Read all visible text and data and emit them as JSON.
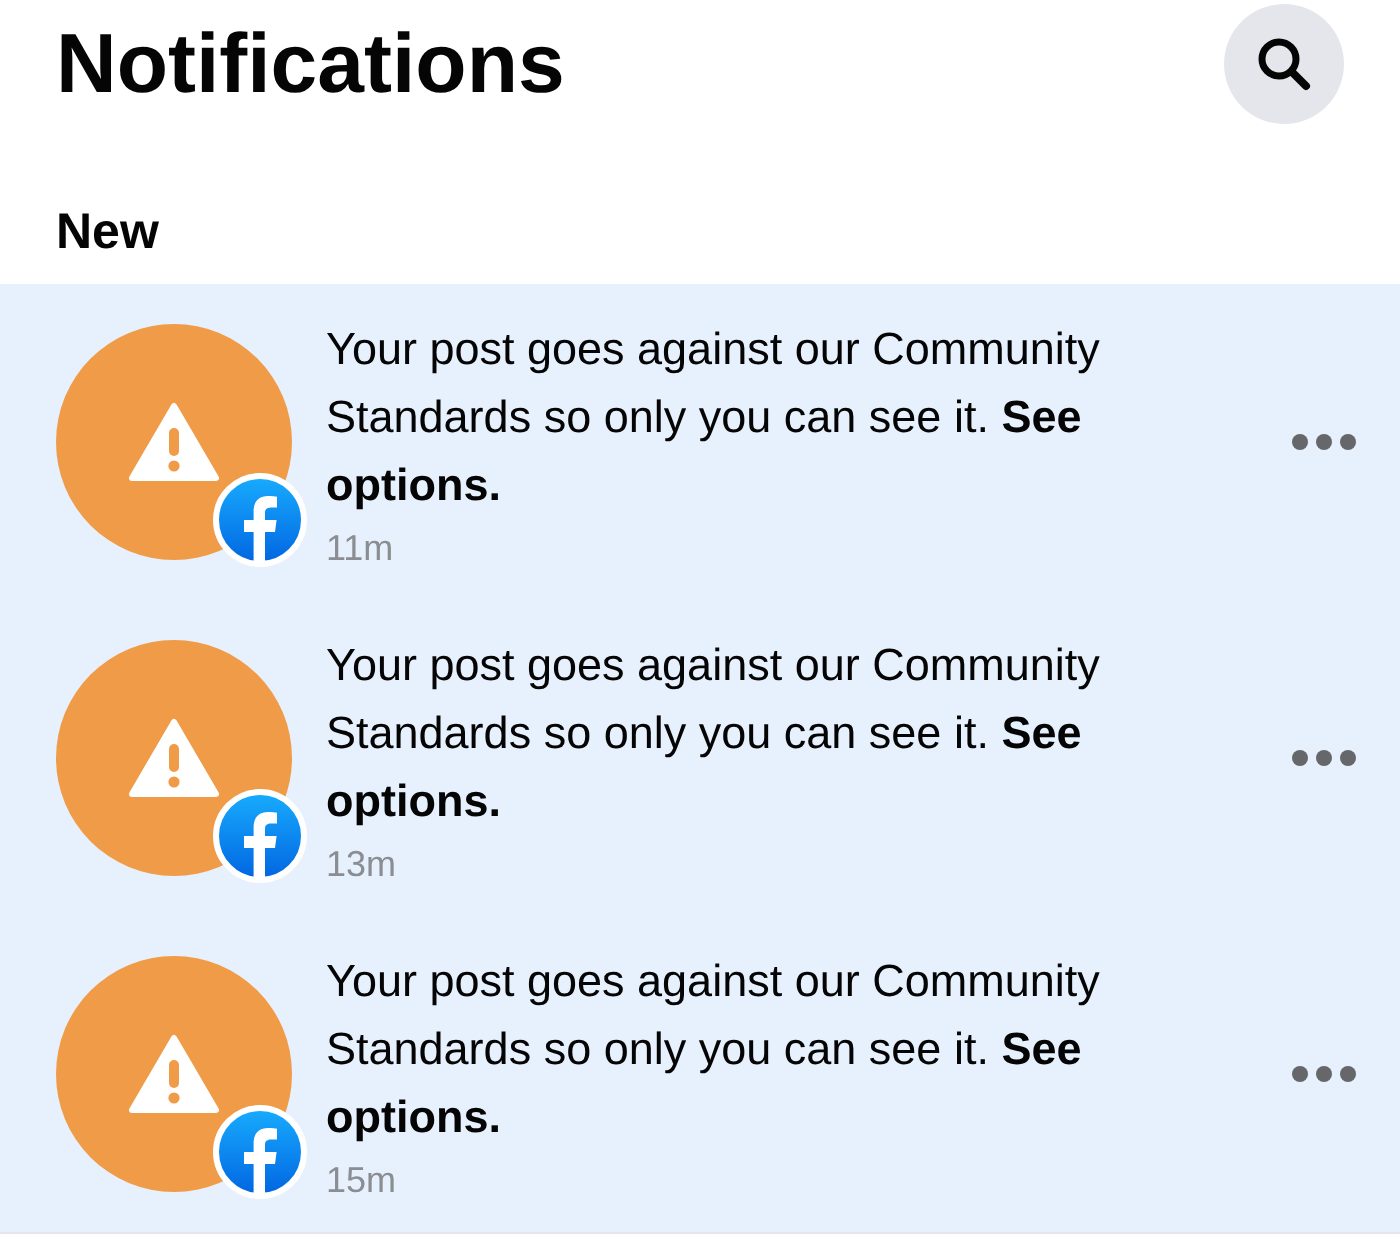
{
  "header": {
    "title": "Notifications"
  },
  "section": {
    "title": "New"
  },
  "notifications": [
    {
      "text": "Your post goes against our Community Standards so only you can see it. **See options.**",
      "time": "11m",
      "unread": true
    },
    {
      "text": "Your post goes against our Community Standards so only you can see it. **See options.**",
      "time": "13m",
      "unread": true
    },
    {
      "text": "Your post goes against our Community Standards so only you can see it. **See options.**",
      "time": "15m",
      "unread": true
    }
  ]
}
